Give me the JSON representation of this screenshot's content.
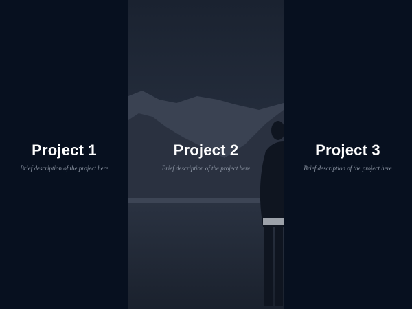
{
  "projects": [
    {
      "title": "Project 1",
      "description": "Brief description of the project here"
    },
    {
      "title": "Project 2",
      "description": "Brief description of the project here"
    },
    {
      "title": "Project 3",
      "description": "Brief description of the project here"
    }
  ],
  "colors": {
    "panel_dark": "#07101f",
    "photo_overlay": "#1b2433",
    "title": "#ffffff",
    "description": "#8e97a5"
  }
}
